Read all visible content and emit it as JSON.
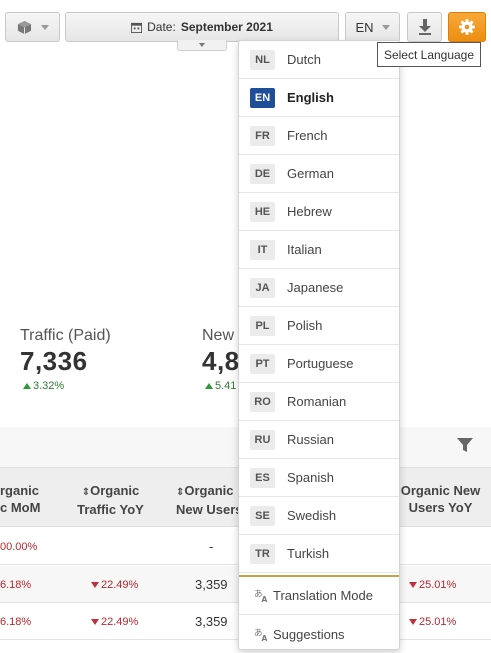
{
  "toolbar": {
    "date_prefix": "Date:",
    "date_value": "September 2021",
    "language_code": "EN",
    "accent_color": "#ef9318"
  },
  "tooltip": {
    "text": "Select Language"
  },
  "metrics": [
    {
      "label": "Traffic (Paid)",
      "value": "7,336",
      "change": "3.32%"
    },
    {
      "label": "New",
      "value": "4,8",
      "change": "5.41"
    }
  ],
  "table": {
    "headers": [
      {
        "line1": "rganic",
        "line2": "c MoM"
      },
      {
        "line1": "Organic",
        "line2": "Traffic YoY"
      },
      {
        "line1": "Organic",
        "line2": "New Users"
      },
      {
        "line1": "Organic New",
        "line2": "Users YoY"
      }
    ],
    "rows": [
      {
        "c1": "00.00%",
        "c2": "",
        "c3": "-",
        "c4": ""
      },
      {
        "c1": "6.18%",
        "c2": "22.49%",
        "c3": "3,359",
        "c4": "25.01%"
      },
      {
        "c1": "6.18%",
        "c2": "22.49%",
        "c3": "3,359",
        "c4": "25.01%"
      }
    ]
  },
  "languages": [
    {
      "code": "NL",
      "name": "Dutch",
      "active": false
    },
    {
      "code": "EN",
      "name": "English",
      "active": true
    },
    {
      "code": "FR",
      "name": "French",
      "active": false
    },
    {
      "code": "DE",
      "name": "German",
      "active": false
    },
    {
      "code": "HE",
      "name": "Hebrew",
      "active": false
    },
    {
      "code": "IT",
      "name": "Italian",
      "active": false
    },
    {
      "code": "JA",
      "name": "Japanese",
      "active": false
    },
    {
      "code": "PL",
      "name": "Polish",
      "active": false
    },
    {
      "code": "PT",
      "name": "Portuguese",
      "active": false
    },
    {
      "code": "RO",
      "name": "Romanian",
      "active": false
    },
    {
      "code": "RU",
      "name": "Russian",
      "active": false
    },
    {
      "code": "ES",
      "name": "Spanish",
      "active": false
    },
    {
      "code": "SE",
      "name": "Swedish",
      "active": false
    },
    {
      "code": "TR",
      "name": "Turkish",
      "active": false
    }
  ],
  "tools": {
    "translation_mode": "Translation Mode",
    "suggestions": "Suggestions"
  }
}
